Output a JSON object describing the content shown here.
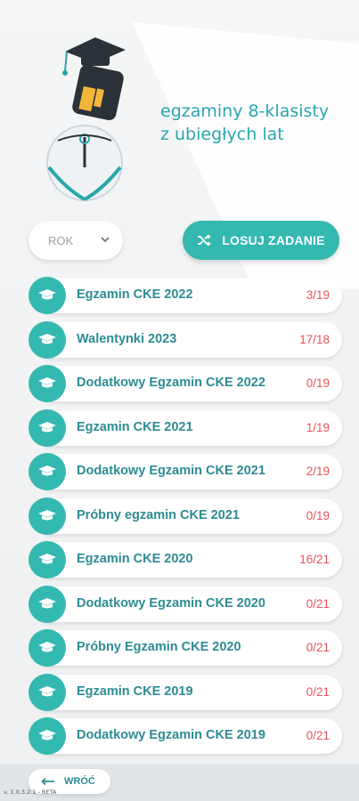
{
  "header": {
    "title_line1": "egzaminy 8-klasisty",
    "title_line2": "z ubiegłych lat"
  },
  "filters": {
    "year_select": {
      "selected": "ROK",
      "icon": "chevron-down-icon"
    },
    "random_button": {
      "label": "LOSUJ ZADANIE",
      "icon": "shuffle-icon"
    }
  },
  "exams": [
    {
      "name": "Egzamin CKE 2022",
      "score": "3/19"
    },
    {
      "name": "Walentynki 2023",
      "score": "17/18"
    },
    {
      "name": "Dodatkowy Egzamin CKE 2022",
      "score": "0/19"
    },
    {
      "name": "Egzamin CKE 2021",
      "score": "1/19"
    },
    {
      "name": "Dodatkowy Egzamin CKE 2021",
      "score": "2/19"
    },
    {
      "name": "Próbny egzamin CKE 2021",
      "score": "0/19"
    },
    {
      "name": "Egzamin CKE 2020",
      "score": "16/21"
    },
    {
      "name": "Dodatkowy Egzamin CKE 2020",
      "score": "0/21"
    },
    {
      "name": "Próbny Egzamin CKE 2020",
      "score": "0/21"
    },
    {
      "name": "Egzamin CKE 2019",
      "score": "0/21"
    },
    {
      "name": "Dodatkowy Egzamin CKE 2019",
      "score": "0/21"
    }
  ],
  "footer": {
    "back_label": "WRÓĆ",
    "version": "v. 1.0.3.2.1 - BETA"
  },
  "colors": {
    "accent": "#34b9b0",
    "title": "#2aa6ad",
    "item_text": "#2c8c93",
    "score": "#e8545a"
  }
}
